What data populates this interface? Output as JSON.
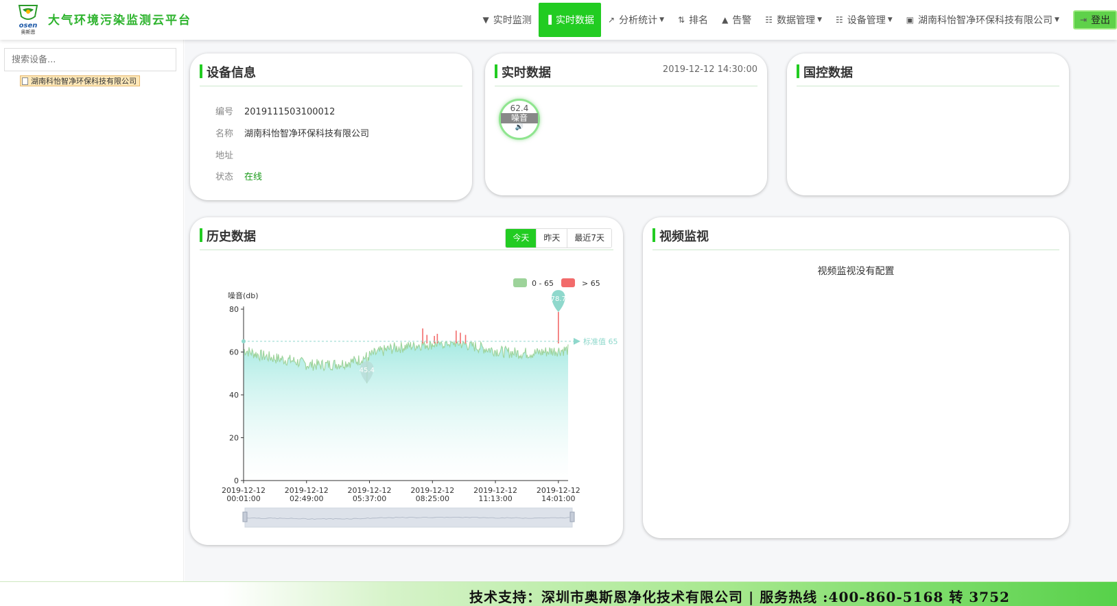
{
  "app": {
    "title": "大气环境污染监测云平台",
    "logo_text": "osen",
    "logo_sub": "奥斯恩"
  },
  "nav": [
    {
      "id": "realtime-monitor",
      "icon": "map-marker-icon",
      "label": "实时监测",
      "caret": false,
      "active": false
    },
    {
      "id": "realtime-data",
      "icon": "bar-chart-icon",
      "label": "实时数据",
      "caret": false,
      "active": true
    },
    {
      "id": "analysis",
      "icon": "line-chart-icon",
      "label": "分析统计",
      "caret": true,
      "active": false
    },
    {
      "id": "ranking",
      "icon": "sort-icon",
      "label": "排名",
      "caret": false,
      "active": false
    },
    {
      "id": "alarm",
      "icon": "bell-icon",
      "label": "告警",
      "caret": false,
      "active": false
    },
    {
      "id": "data-management",
      "icon": "sitemap-icon",
      "label": "数据管理",
      "caret": true,
      "active": false
    },
    {
      "id": "device-management",
      "icon": "sitemap-icon",
      "label": "设备管理",
      "caret": true,
      "active": false
    },
    {
      "id": "company",
      "icon": "id-card-icon",
      "label": "湖南科怡智净环保科技有限公司",
      "caret": true,
      "active": false
    }
  ],
  "logout_label": "登出",
  "sidebar": {
    "search_placeholder": "搜索设备...",
    "tree_item": "湖南科怡智净环保科技有限公司"
  },
  "device_info": {
    "title": "设备信息",
    "rows": [
      {
        "key": "编号",
        "value": "2019111503100012"
      },
      {
        "key": "名称",
        "value": "湖南科怡智净环保科技有限公司"
      },
      {
        "key": "地址",
        "value": ""
      },
      {
        "key": "状态",
        "value": "在线"
      }
    ]
  },
  "realtime": {
    "title": "实时数据",
    "time": "2019-12-12 14:30:00",
    "gauge_value": "62.4",
    "gauge_label": "噪音"
  },
  "national": {
    "title": "国控数据"
  },
  "history": {
    "title": "历史数据",
    "tabs": [
      "今天",
      "昨天",
      "最近7天"
    ],
    "active_tab": 0
  },
  "video": {
    "title": "视频监视",
    "message": "视频监视没有配置"
  },
  "chart_data": {
    "type": "area",
    "ylabel": "噪音(db)",
    "ylim": [
      0,
      80
    ],
    "yticks": [
      0,
      20,
      40,
      60,
      80
    ],
    "xlabels": [
      [
        "2019-12-12",
        "00:01:00"
      ],
      [
        "2019-12-12",
        "02:49:00"
      ],
      [
        "2019-12-12",
        "05:37:00"
      ],
      [
        "2019-12-12",
        "08:25:00"
      ],
      [
        "2019-12-12",
        "11:13:00"
      ],
      [
        "2019-12-12",
        "14:01:00"
      ]
    ],
    "legend": [
      {
        "label": "0 - 65",
        "color": "#9dd39a"
      },
      {
        "label": "> 65",
        "color": "#f26b6b"
      }
    ],
    "markline": {
      "label": "标准值 65",
      "value": 65
    },
    "max_marker": {
      "value": "78.7"
    },
    "min_marker": {
      "value": "45.4"
    },
    "series_profile": [
      [
        0.0,
        61
      ],
      [
        0.05,
        58.5
      ],
      [
        0.1,
        57
      ],
      [
        0.15,
        56
      ],
      [
        0.2,
        54
      ],
      [
        0.25,
        54
      ],
      [
        0.3,
        54.5
      ],
      [
        0.35,
        56
      ],
      [
        0.4,
        59
      ],
      [
        0.45,
        61.5
      ],
      [
        0.5,
        62.5
      ],
      [
        0.55,
        63.5
      ],
      [
        0.6,
        64
      ],
      [
        0.65,
        64.5
      ],
      [
        0.7,
        63
      ],
      [
        0.75,
        61.5
      ],
      [
        0.8,
        60
      ],
      [
        0.85,
        59.5
      ],
      [
        0.9,
        59.5
      ],
      [
        0.95,
        60.5
      ],
      [
        1.0,
        61
      ]
    ],
    "spikes": [
      [
        0.552,
        71
      ],
      [
        0.565,
        68
      ],
      [
        0.588,
        67.5
      ],
      [
        0.597,
        68.5
      ],
      [
        0.655,
        70
      ],
      [
        0.668,
        69
      ],
      [
        0.684,
        68
      ],
      [
        0.97,
        78.7
      ]
    ],
    "min_point": [
      0.38,
      45.4
    ]
  }
}
